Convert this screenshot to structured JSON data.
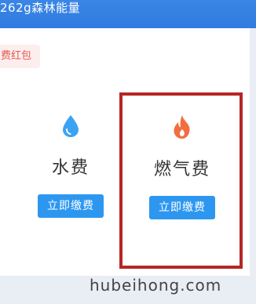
{
  "banner": {
    "energy_text": "262g森林能量"
  },
  "coupon": {
    "label": "费红包"
  },
  "services": [
    {
      "name": "水费",
      "button_label": "立即缴费",
      "icon": "water-drop-icon",
      "icon_color": "#3ba3f3"
    },
    {
      "name": "燃气费",
      "button_label": "立即缴费",
      "icon": "flame-icon",
      "icon_color": "#f26e3f"
    }
  ],
  "watermark": {
    "text": "hubeihong.com"
  },
  "colors": {
    "banner": "#2f7be0",
    "button": "#2d97f0",
    "highlight_border": "#b52623",
    "coupon_text": "#e8584c"
  }
}
